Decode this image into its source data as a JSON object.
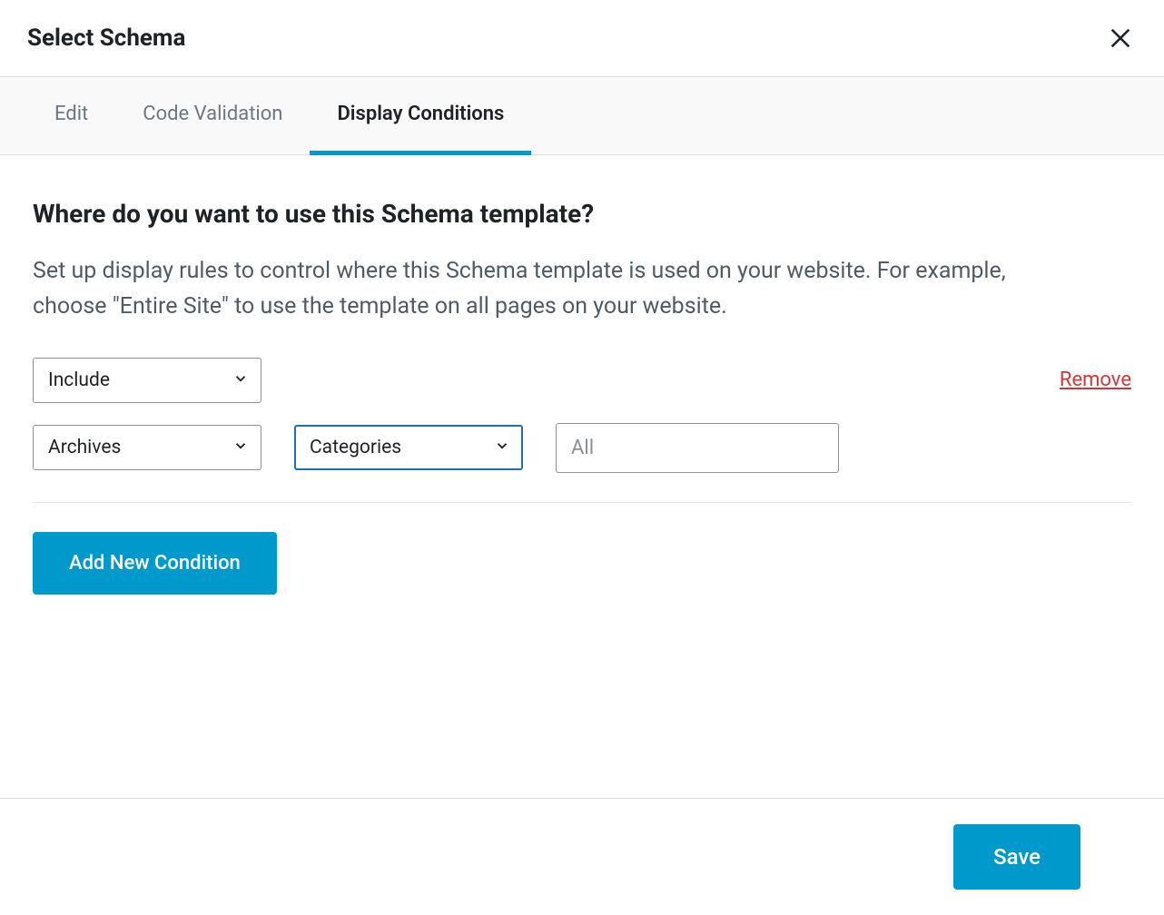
{
  "header": {
    "title": "Select Schema"
  },
  "tabs": {
    "edit": "Edit",
    "code_validation": "Code Validation",
    "display_conditions": "Display Conditions"
  },
  "content": {
    "heading": "Where do you want to use this Schema template?",
    "description": "Set up display rules to control where this Schema template is used on your website. For example, choose \"Entire Site\" to use the template on all pages on your website."
  },
  "condition": {
    "include_value": "Include",
    "archives_value": "Archives",
    "categories_value": "Categories",
    "all_placeholder": "All",
    "remove_label": "Remove"
  },
  "actions": {
    "add_condition": "Add New Condition",
    "save": "Save"
  }
}
